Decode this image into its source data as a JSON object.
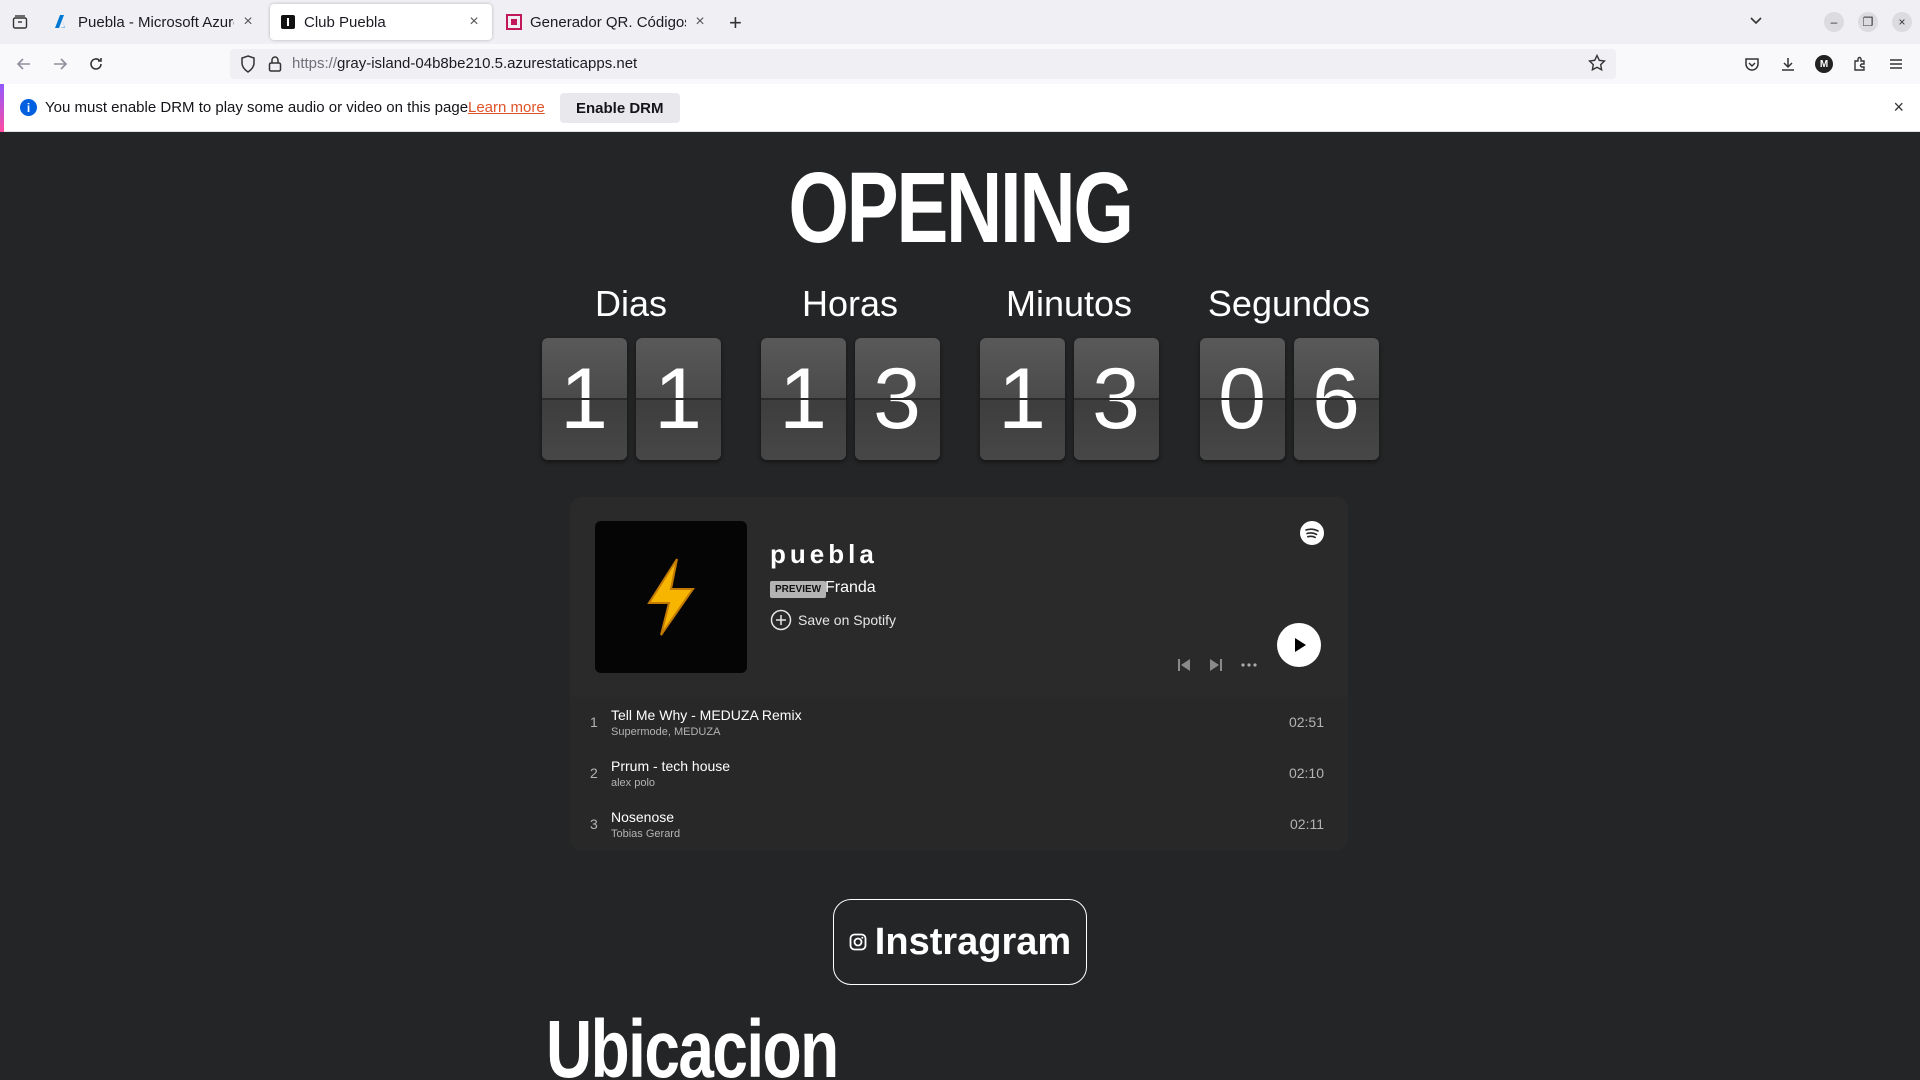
{
  "browser": {
    "tabs": [
      {
        "title": "Puebla - Microsoft Azure",
        "active": false
      },
      {
        "title": "Club Puebla",
        "active": true
      },
      {
        "title": "Generador QR. Códigos QR",
        "active": false
      }
    ],
    "url_protocol": "https://",
    "url_host": "gray-island-04b8be210.5.azurestaticapps.net",
    "profile_initial": "M"
  },
  "drm": {
    "message": "You must enable DRM to play some audio or video on this page.",
    "learn_more": "Learn more",
    "button": "Enable DRM"
  },
  "page": {
    "heading": "OPENING",
    "countdown": [
      {
        "label": "Dias",
        "digits": [
          "1",
          "1"
        ]
      },
      {
        "label": "Horas",
        "digits": [
          "1",
          "3"
        ]
      },
      {
        "label": "Minutos",
        "digits": [
          "1",
          "3"
        ]
      },
      {
        "label": "Segundos",
        "digits": [
          "0",
          "6"
        ]
      }
    ],
    "spotify": {
      "playlist_title": "puebla",
      "preview_badge": "PREVIEW",
      "artist": "Franda",
      "save_label": "Save on Spotify",
      "cover_icon": "lightning-emoji",
      "tracks": [
        {
          "num": "1",
          "name": "Tell Me Why - MEDUZA Remix",
          "artist": "Supermode, MEDUZA",
          "duration": "02:51"
        },
        {
          "num": "2",
          "name": "Prrum - tech house",
          "artist": "alex polo",
          "duration": "02:10"
        },
        {
          "num": "3",
          "name": "Nosenose",
          "artist": "Tobias Gerard",
          "duration": "02:11"
        }
      ]
    },
    "instagram_label": "Instragram",
    "location_heading": "Ubicacion"
  },
  "colors": {
    "page_bg": "#242526",
    "digit_bg": "#4a4a4a",
    "spotify_bg": "#282828",
    "drm_accent": "#0060df",
    "learn_more": "#e0542a"
  }
}
